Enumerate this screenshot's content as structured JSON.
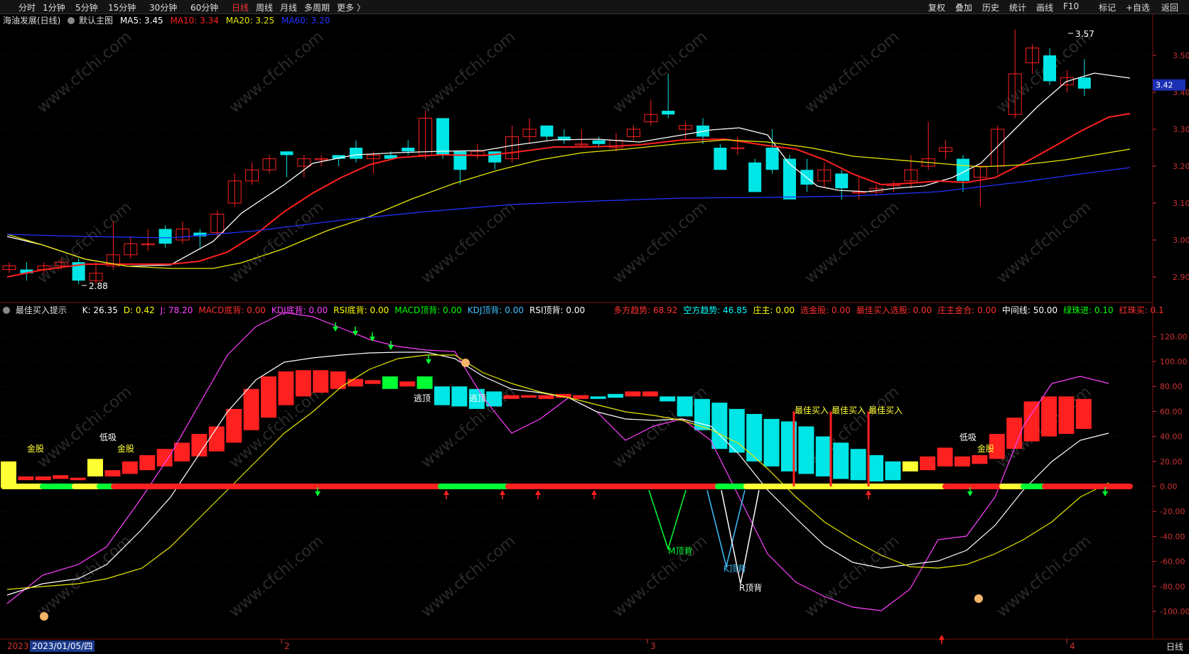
{
  "toolbar": {
    "periods": [
      "分时",
      "1分钟",
      "5分钟",
      "15分钟",
      "30分钟",
      "60分钟",
      "日线",
      "周线",
      "月线",
      "多周期",
      "更多 〉"
    ],
    "active_period": "日线",
    "right_buttons": [
      "复权",
      "叠加",
      "历史",
      "统计",
      "画线",
      "F10",
      "标记",
      "+自选",
      "返回"
    ]
  },
  "main_header": {
    "stock": "海油发展(日线)",
    "template": "默认主图",
    "ma5": "MA5: 3.45",
    "ma10": "MA10: 3.34",
    "ma20": "MA20: 3.25",
    "ma60": "MA60: 3.20"
  },
  "indicator_header": {
    "name": "最佳买入提示",
    "items": [
      {
        "t": "K: 26.35",
        "c": "#ffffff"
      },
      {
        "t": "D: 0.42",
        "c": "#ffff00"
      },
      {
        "t": "J: 78.20",
        "c": "#ff40ff"
      },
      {
        "t": "MACD底背: 0.00",
        "c": "#ff3030"
      },
      {
        "t": "KDJ底背: 0.00",
        "c": "#ff40ff"
      },
      {
        "t": "RSI底背: 0.00",
        "c": "#ffff00"
      },
      {
        "t": "MACD顶背: 0.00",
        "c": "#00ff00"
      },
      {
        "t": "KDJ顶背: 0.00",
        "c": "#40c0ff"
      },
      {
        "t": "RSI顶背: 0.00",
        "c": "#ffffff"
      },
      {
        "t": "多方趋势: 68.92",
        "c": "#ff3030"
      },
      {
        "t": "空方趋势: 46.85",
        "c": "#00ffff"
      },
      {
        "t": "庄主: 0.00",
        "c": "#ffff00"
      },
      {
        "t": "选金股: 0.00",
        "c": "#ff3030"
      },
      {
        "t": "最佳买入选股: 0.00",
        "c": "#ff3030"
      },
      {
        "t": "庄主金合: 0.00",
        "c": "#ff3030"
      },
      {
        "t": "中间线: 50.00",
        "c": "#ffffff"
      },
      {
        "t": "绿珠进: 0.10",
        "c": "#00ff00"
      },
      {
        "t": "红珠买: 0.1",
        "c": "#ff3030"
      }
    ]
  },
  "price_axis": [
    "3.50",
    "3.40",
    "3.30",
    "3.20",
    "3.10",
    "3.00",
    "2.90"
  ],
  "current_price": "3.42",
  "price_annotations": {
    "high": "3.57",
    "low": "2.88"
  },
  "indicator_axis": [
    "120.00",
    "100.00",
    "80.00",
    "60.00",
    "40.00",
    "20.00",
    "0.00",
    "-20.00",
    "-40.00",
    "-60.00",
    "-80.00",
    "-100.00"
  ],
  "signals": {
    "gold": "金股",
    "low_buy": "低吸",
    "escape_top": "逃顶",
    "best_buy": "最佳买入",
    "m_top": "M顶背",
    "k_top": "K顶背",
    "r_top": "R顶背"
  },
  "date_axis": {
    "year": "2023",
    "cursor_date": "2023/01/05/四",
    "months": [
      "2",
      "3",
      "4"
    ],
    "period": "日线"
  },
  "watermark": "www.cfchi.com",
  "colors": {
    "up": "#ff2020",
    "down": "#00e5e5",
    "ma5": "#ffffff",
    "ma10": "#ff2020",
    "ma20": "#e6e600",
    "ma60": "#2233ff"
  }
}
